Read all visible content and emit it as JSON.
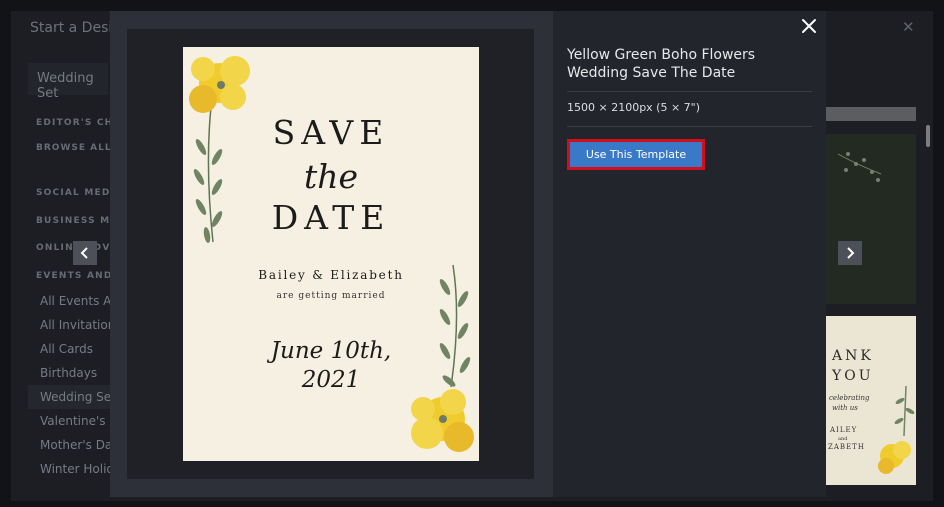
{
  "background": {
    "title": "Start a Design",
    "search_value": "Wedding Set",
    "section_labels": [
      "EDITOR'S CHOICE",
      "BROWSE ALL TEMPLATES",
      "SOCIAL MEDIA",
      "BUSINESS MARKETING",
      "ONLINE ADVERTISING",
      "EVENTS AND OCCASIONS"
    ],
    "categories": [
      "All Events And",
      "All Invitations",
      "All Cards",
      "Birthdays",
      "Wedding Set",
      "Valentine's Day",
      "Mother's Day",
      "Winter Holidays"
    ],
    "thumb_text": [
      "ANK",
      "YOU",
      "celebrating",
      "with us",
      "AILEY",
      "and",
      "ZABETH"
    ]
  },
  "modal": {
    "template_title": "Yellow Green Boho Flowers Wedding Save The Date",
    "dimensions": "1500 × 2100px (5 × 7\")",
    "use_button_label": "Use This Template",
    "accent_color": "#3a79c7",
    "highlight_color": "#d30d1a"
  },
  "card": {
    "line1": "SAVE",
    "line2": "the",
    "line3": "DATE",
    "names": "Bailey & Elizabeth",
    "subline": "are getting married",
    "date_line1": "June 10th,",
    "date_line2": "2021",
    "flower_color": "#f0cb2c",
    "leaf_color": "#6f8562"
  },
  "icons": {
    "modal_close": "close-icon",
    "background_close": "close-icon",
    "prev": "chevron-left-icon",
    "next": "chevron-right-icon"
  }
}
